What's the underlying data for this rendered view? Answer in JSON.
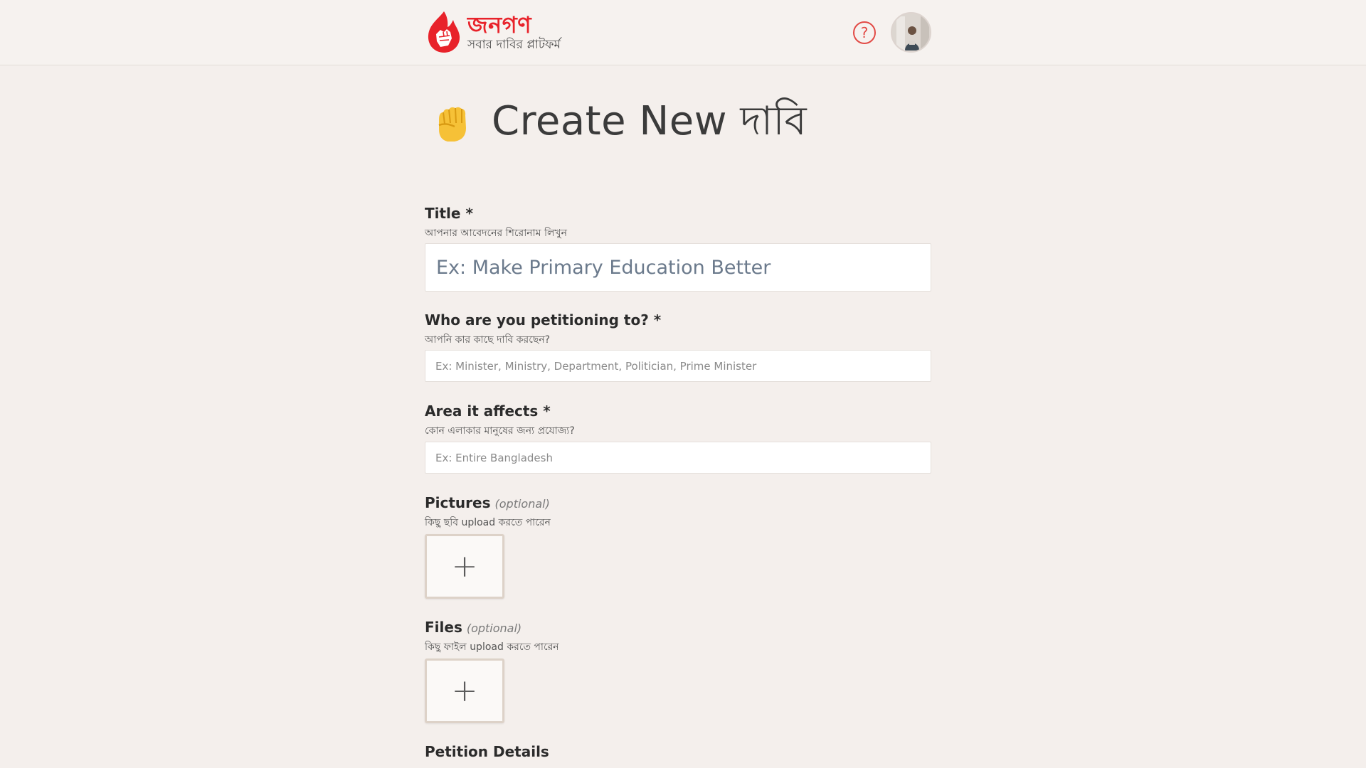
{
  "header": {
    "brand_name": "জনগণ",
    "brand_tagline": "সবার দাবির প্লাটফর্ম",
    "help_label": "?"
  },
  "page": {
    "title": "Create New দাবি"
  },
  "form": {
    "title_field": {
      "label": "Title *",
      "hint": "আপনার আবেদনের শিরোনাম লিখুন",
      "placeholder": "Ex: Make Primary Education Better",
      "value": ""
    },
    "target_field": {
      "label": "Who are you petitioning to? *",
      "hint": "আপনি কার কাছে দাবি করছেন?",
      "placeholder": "Ex: Minister, Ministry, Department, Politician, Prime Minister",
      "value": ""
    },
    "area_field": {
      "label": "Area it affects *",
      "hint": "কোন এলাকার মানুষের জন্য প্রযোজ্য?",
      "placeholder": "Ex: Entire Bangladesh",
      "value": ""
    },
    "pictures_field": {
      "label": "Pictures",
      "optional": "(optional)",
      "hint": "কিছু ছবি upload করতে পারেন",
      "add_symbol": "+"
    },
    "files_field": {
      "label": "Files",
      "optional": "(optional)",
      "hint": "কিছু ফাইল upload করতে পারেন",
      "add_symbol": "+"
    },
    "details_field": {
      "label": "Petition Details"
    }
  },
  "icons": {
    "logo": "fist-flame-logo-icon",
    "help": "question-circle-icon",
    "heading": "raised-fist-icon"
  },
  "colors": {
    "background": "#f4efec",
    "brand_red": "#e8222a",
    "fist_yellow": "#f6c137"
  }
}
